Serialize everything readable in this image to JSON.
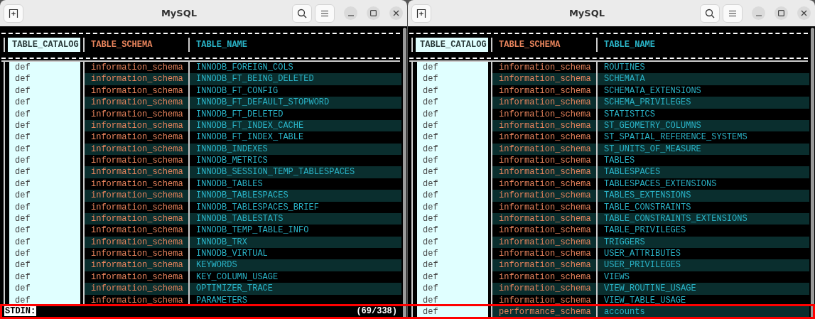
{
  "windows": [
    {
      "title": "MySQL",
      "columns": [
        {
          "label": "TABLE_CATALOG",
          "selected": true,
          "color": "#2a3a3a"
        },
        {
          "label": "TABLE_SCHEMA",
          "selected": false,
          "color": "#e8845c"
        },
        {
          "label": "TABLE_NAME",
          "selected": false,
          "color": "#2ab4c8"
        }
      ],
      "rows": [
        {
          "catalog": "def",
          "schema": "information_schema",
          "name": "INNODB_FOREIGN_COLS"
        },
        {
          "catalog": "def",
          "schema": "information_schema",
          "name": "INNODB_FT_BEING_DELETED"
        },
        {
          "catalog": "def",
          "schema": "information_schema",
          "name": "INNODB_FT_CONFIG"
        },
        {
          "catalog": "def",
          "schema": "information_schema",
          "name": "INNODB_FT_DEFAULT_STOPWORD"
        },
        {
          "catalog": "def",
          "schema": "information_schema",
          "name": "INNODB_FT_DELETED"
        },
        {
          "catalog": "def",
          "schema": "information_schema",
          "name": "INNODB_FT_INDEX_CACHE"
        },
        {
          "catalog": "def",
          "schema": "information_schema",
          "name": "INNODB_FT_INDEX_TABLE"
        },
        {
          "catalog": "def",
          "schema": "information_schema",
          "name": "INNODB_INDEXES"
        },
        {
          "catalog": "def",
          "schema": "information_schema",
          "name": "INNODB_METRICS"
        },
        {
          "catalog": "def",
          "schema": "information_schema",
          "name": "INNODB_SESSION_TEMP_TABLESPACES"
        },
        {
          "catalog": "def",
          "schema": "information_schema",
          "name": "INNODB_TABLES"
        },
        {
          "catalog": "def",
          "schema": "information_schema",
          "name": "INNODB_TABLESPACES"
        },
        {
          "catalog": "def",
          "schema": "information_schema",
          "name": "INNODB_TABLESPACES_BRIEF"
        },
        {
          "catalog": "def",
          "schema": "information_schema",
          "name": "INNODB_TABLESTATS"
        },
        {
          "catalog": "def",
          "schema": "information_schema",
          "name": "INNODB_TEMP_TABLE_INFO"
        },
        {
          "catalog": "def",
          "schema": "information_schema",
          "name": "INNODB_TRX"
        },
        {
          "catalog": "def",
          "schema": "information_schema",
          "name": "INNODB_VIRTUAL"
        },
        {
          "catalog": "def",
          "schema": "information_schema",
          "name": "KEYWORDS"
        },
        {
          "catalog": "def",
          "schema": "information_schema",
          "name": "KEY_COLUMN_USAGE"
        },
        {
          "catalog": "def",
          "schema": "information_schema",
          "name": "OPTIMIZER_TRACE"
        },
        {
          "catalog": "def",
          "schema": "information_schema",
          "name": "PARAMETERS"
        }
      ],
      "status": {
        "prompt": "STDIN:",
        "position": "(69/338)"
      }
    },
    {
      "title": "MySQL",
      "columns": [
        {
          "label": "TABLE_CATALOG",
          "selected": true,
          "color": "#2a3a3a"
        },
        {
          "label": "TABLE_SCHEMA",
          "selected": false,
          "color": "#e8845c"
        },
        {
          "label": "TABLE_NAME",
          "selected": false,
          "color": "#2ab4c8"
        }
      ],
      "rows": [
        {
          "catalog": "def",
          "schema": "information_schema",
          "name": "ROUTINES"
        },
        {
          "catalog": "def",
          "schema": "information_schema",
          "name": "SCHEMATA"
        },
        {
          "catalog": "def",
          "schema": "information_schema",
          "name": "SCHEMATA_EXTENSIONS"
        },
        {
          "catalog": "def",
          "schema": "information_schema",
          "name": "SCHEMA_PRIVILEGES"
        },
        {
          "catalog": "def",
          "schema": "information_schema",
          "name": "STATISTICS"
        },
        {
          "catalog": "def",
          "schema": "information_schema",
          "name": "ST_GEOMETRY_COLUMNS"
        },
        {
          "catalog": "def",
          "schema": "information_schema",
          "name": "ST_SPATIAL_REFERENCE_SYSTEMS"
        },
        {
          "catalog": "def",
          "schema": "information_schema",
          "name": "ST_UNITS_OF_MEASURE"
        },
        {
          "catalog": "def",
          "schema": "information_schema",
          "name": "TABLES"
        },
        {
          "catalog": "def",
          "schema": "information_schema",
          "name": "TABLESPACES"
        },
        {
          "catalog": "def",
          "schema": "information_schema",
          "name": "TABLESPACES_EXTENSIONS"
        },
        {
          "catalog": "def",
          "schema": "information_schema",
          "name": "TABLES_EXTENSIONS"
        },
        {
          "catalog": "def",
          "schema": "information_schema",
          "name": "TABLE_CONSTRAINTS"
        },
        {
          "catalog": "def",
          "schema": "information_schema",
          "name": "TABLE_CONSTRAINTS_EXTENSIONS"
        },
        {
          "catalog": "def",
          "schema": "information_schema",
          "name": "TABLE_PRIVILEGES"
        },
        {
          "catalog": "def",
          "schema": "information_schema",
          "name": "TRIGGERS"
        },
        {
          "catalog": "def",
          "schema": "information_schema",
          "name": "USER_ATTRIBUTES"
        },
        {
          "catalog": "def",
          "schema": "information_schema",
          "name": "USER_PRIVILEGES"
        },
        {
          "catalog": "def",
          "schema": "information_schema",
          "name": "VIEWS"
        },
        {
          "catalog": "def",
          "schema": "information_schema",
          "name": "VIEW_ROUTINE_USAGE"
        },
        {
          "catalog": "def",
          "schema": "information_schema",
          "name": "VIEW_TABLE_USAGE"
        },
        {
          "catalog": "def",
          "schema": "performance_schema",
          "name": "accounts"
        }
      ]
    }
  ]
}
